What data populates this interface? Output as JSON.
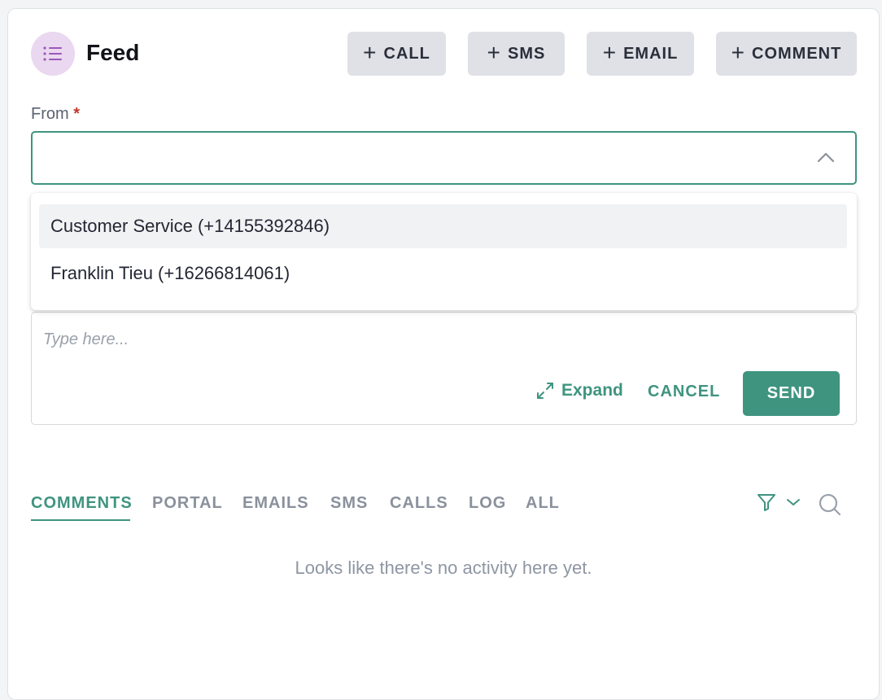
{
  "header": {
    "icon": "list-icon",
    "title": "Feed"
  },
  "actions": {
    "call_label": "CALL",
    "sms_label": "SMS",
    "email_label": "EMAIL",
    "comment_label": "COMMENT",
    "plus_glyph": "+"
  },
  "from_field": {
    "label": "From",
    "required_mark": "*",
    "value": "",
    "options": [
      {
        "label": "Customer Service (+14155392846)",
        "highlighted": true
      },
      {
        "label": "Franklin Tieu (+16266814061)",
        "highlighted": false
      }
    ]
  },
  "composer": {
    "placeholder": "Type here...",
    "expand_label": "Expand",
    "cancel_label": "CANCEL",
    "send_label": "SEND"
  },
  "tabs": [
    {
      "label": "COMMENTS",
      "active": true
    },
    {
      "label": "PORTAL",
      "active": false
    },
    {
      "label": "EMAILS",
      "active": false
    },
    {
      "label": "SMS",
      "active": false
    },
    {
      "label": "CALLS",
      "active": false
    },
    {
      "label": "LOG",
      "active": false
    },
    {
      "label": "ALL",
      "active": false
    }
  ],
  "empty_state": "Looks like there's no activity here yet.",
  "colors": {
    "accent": "#3f9480",
    "icon_bg": "#ead7f0",
    "icon_fg": "#9b59b6",
    "button_bg": "#dfe1e6"
  }
}
